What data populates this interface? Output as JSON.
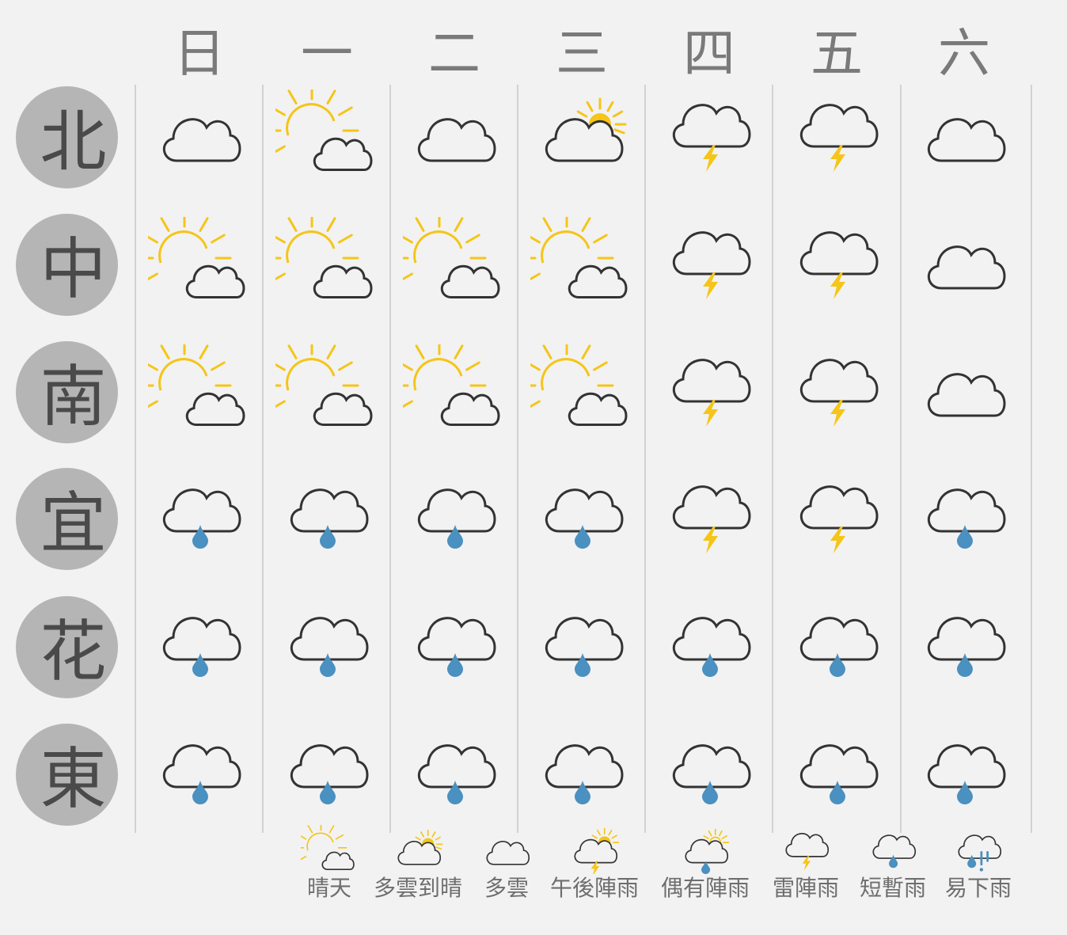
{
  "days": [
    "日",
    "一",
    "二",
    "三",
    "四",
    "五",
    "六"
  ],
  "regions": [
    {
      "label": "北",
      "forecast": [
        "cloudy",
        "sunny",
        "cloudy",
        "cloudy-to-sunny",
        "thunderstorm",
        "thunderstorm",
        "cloudy"
      ]
    },
    {
      "label": "中",
      "forecast": [
        "sunny",
        "sunny",
        "sunny",
        "sunny",
        "thunderstorm",
        "thunderstorm",
        "cloudy"
      ]
    },
    {
      "label": "南",
      "forecast": [
        "sunny",
        "sunny",
        "sunny",
        "sunny",
        "thunderstorm",
        "thunderstorm",
        "cloudy"
      ]
    },
    {
      "label": "宜",
      "forecast": [
        "showers",
        "showers",
        "showers",
        "showers",
        "thunderstorm",
        "thunderstorm",
        "showers"
      ]
    },
    {
      "label": "花",
      "forecast": [
        "showers",
        "showers",
        "showers",
        "showers",
        "showers",
        "showers",
        "showers"
      ]
    },
    {
      "label": "東",
      "forecast": [
        "showers",
        "showers",
        "showers",
        "showers",
        "showers",
        "showers",
        "showers"
      ]
    }
  ],
  "legend": [
    {
      "icon": "sunny",
      "label": "晴天"
    },
    {
      "icon": "cloudy-to-sunny",
      "label": "多雲到晴"
    },
    {
      "icon": "cloudy",
      "label": "多雲"
    },
    {
      "icon": "afternoon-thunder",
      "label": "午後陣雨"
    },
    {
      "icon": "occasional-showers",
      "label": "偶有陣雨"
    },
    {
      "icon": "thunderstorm",
      "label": "雷陣雨"
    },
    {
      "icon": "showers",
      "label": "短暫雨"
    },
    {
      "icon": "rain-likely",
      "label": "易下雨"
    }
  ],
  "colors": {
    "background": "#f2f2f2",
    "sun": "#f5c518",
    "cloud_outline": "#333333",
    "raindrop": "#4a90c0",
    "lightning": "#f5c518",
    "region_circle": "#b5b5b5",
    "region_text": "#4a4a4a",
    "day_text": "#7a7a7a",
    "divider": "#d2d2d2"
  }
}
